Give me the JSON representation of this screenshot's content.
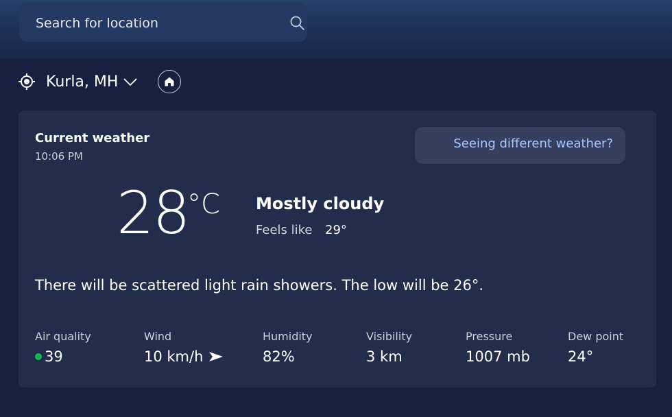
{
  "search": {
    "placeholder": "Search for location",
    "icon": "search-icon"
  },
  "location": {
    "name": "Kurla, MH",
    "icon": "location-target-icon",
    "home_icon": "home-icon"
  },
  "current": {
    "title": "Current weather",
    "time": "10:06 PM",
    "feedback_button": "Seeing different weather?",
    "temperature": "28",
    "unit": "°C",
    "condition": "Mostly cloudy",
    "feels_like_label": "Feels like",
    "feels_like_value": "29°",
    "summary": "There will be scattered light rain showers. The low will be 26°."
  },
  "stats": {
    "air_quality": {
      "label": "Air quality",
      "value": "39",
      "color": "#14b84d"
    },
    "wind": {
      "label": "Wind",
      "value": "10 km/h",
      "icon": "wind-direction-arrow-icon"
    },
    "humidity": {
      "label": "Humidity",
      "value": "82%"
    },
    "visibility": {
      "label": "Visibility",
      "value": "3 km"
    },
    "pressure": {
      "label": "Pressure",
      "value": "1007 mb"
    },
    "dew_point": {
      "label": "Dew point",
      "value": "24°"
    }
  },
  "colors": {
    "background": "#17213f",
    "card": "#222d4b",
    "accent_link": "#a9c8ff"
  }
}
